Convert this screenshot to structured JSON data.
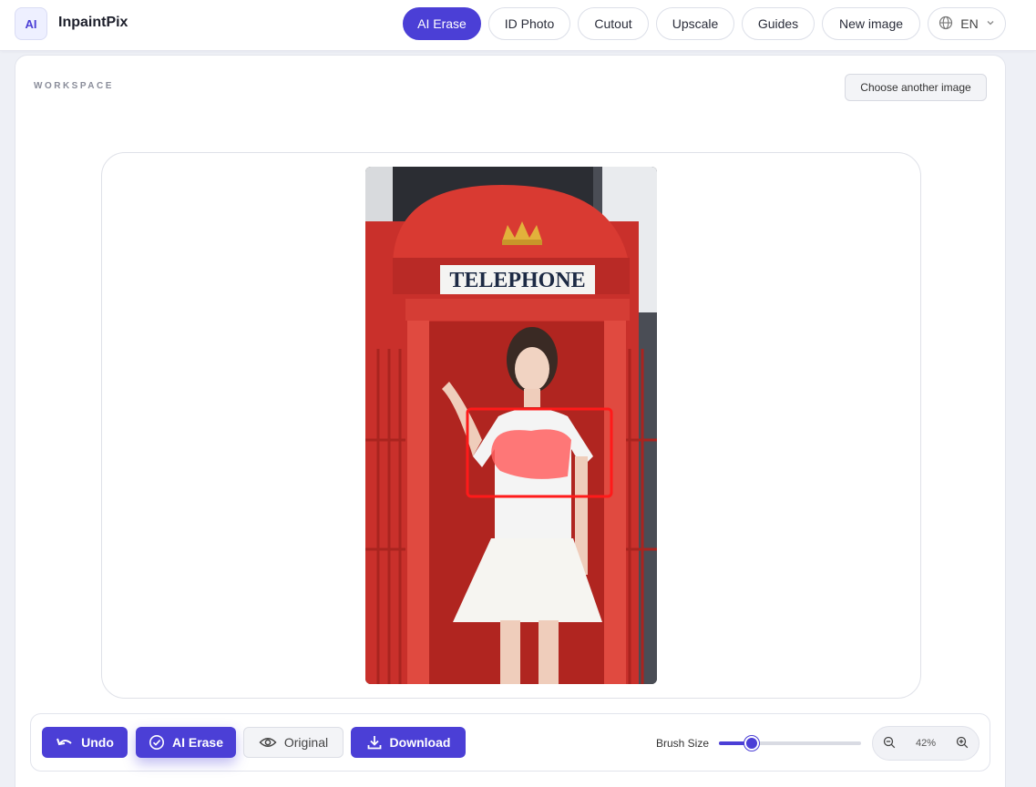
{
  "app": {
    "logo_text": "AI",
    "name": "InpaintPix"
  },
  "nav": {
    "items": [
      {
        "label": "AI Erase",
        "active": true
      },
      {
        "label": "ID Photo"
      },
      {
        "label": "Cutout"
      },
      {
        "label": "Upscale"
      },
      {
        "label": "Guides"
      },
      {
        "label": "New image"
      }
    ],
    "language": {
      "label": "EN",
      "icon": "globe-icon"
    }
  },
  "workspace": {
    "label": "WORKSPACE",
    "choose_button": "Choose another image",
    "image": {
      "sign_text": "TELEPHONE",
      "selection_color": "#ff1a1a"
    }
  },
  "toolbar": {
    "undo": "Undo",
    "ai_erase": "AI Erase",
    "original": "Original",
    "download": "Download",
    "brush_size_label": "Brush Size",
    "brush_size_fraction": 0.2,
    "zoom": "42%"
  },
  "colors": {
    "accent": "#4b3fd6",
    "background": "#eef0f6"
  }
}
